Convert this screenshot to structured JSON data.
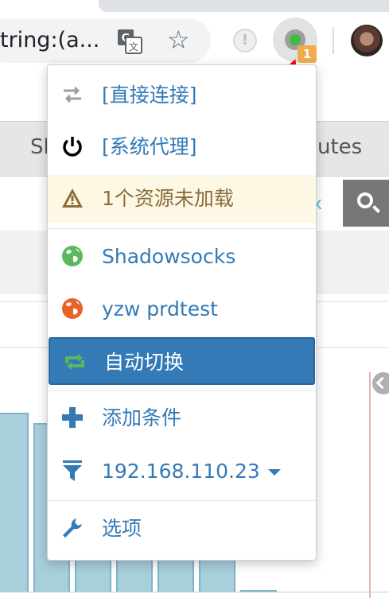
{
  "browser": {
    "address_text": "tring:(a...",
    "extension_badge_count": "1",
    "icons": [
      "translate-icon",
      "bookmark-star-icon",
      "extension-error-icon",
      "switchyomega-icon",
      "profile-avatar"
    ]
  },
  "background_page": {
    "nav_left": "Sl",
    "nav_right": "utes",
    "clear_x": "x",
    "chart_bars": [
      0.98,
      0.92,
      0.67,
      0.62,
      0.62,
      0.61,
      0.0
    ]
  },
  "popup": {
    "items": [
      {
        "label": "[直接连接]",
        "icon": "direct-connection-icon",
        "icon_color": "#9e9e9e"
      },
      {
        "label": "[系统代理]",
        "icon": "power-icon",
        "icon_color": "#000000"
      },
      {
        "label": "1个资源未加载",
        "icon": "warning-icon",
        "icon_color": "#8a6d3b"
      },
      {
        "label": "Shadowsocks",
        "icon": "globe-icon",
        "icon_color": "#5cb85c"
      },
      {
        "label": "yzw prdtest",
        "icon": "globe-icon",
        "icon_color": "#e8622a"
      },
      {
        "label": "自动切换",
        "icon": "auto-switch-icon",
        "icon_color": "#5cb85c"
      },
      {
        "label": "添加条件",
        "icon": "plus-icon",
        "icon_color": "#337ab7"
      },
      {
        "label": "192.168.110.23",
        "icon": "filter-icon",
        "icon_color": "#337ab7"
      },
      {
        "label": "选项",
        "icon": "wrench-icon",
        "icon_color": "#337ab7"
      }
    ]
  },
  "colors": {
    "link_blue": "#337ab7",
    "selected_bg": "#337ab7",
    "warning_bg": "#fcf8e3",
    "warning_text": "#8a6d3b",
    "badge": "#f0ad4e",
    "annotation_arrow": "#ff0000"
  }
}
